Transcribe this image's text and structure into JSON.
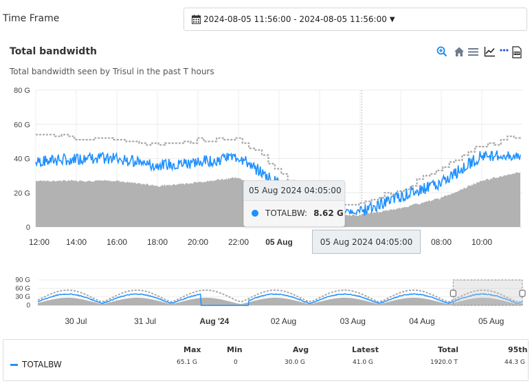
{
  "time_frame": {
    "label": "Time Frame",
    "value": "2024-08-05 11:56:00 - 2024-08-05 11:56:00",
    "icon": "calendar-icon"
  },
  "chart_header": {
    "title": "Total bandwidth",
    "subtitle": "Total bandwidth seen by Trisul in the past T hours"
  },
  "toolbar": {
    "items": [
      "zoom-in-icon",
      "home-icon",
      "menu-icon",
      "line-chart-icon",
      "more-icon",
      "pdf-icon"
    ]
  },
  "tooltip": {
    "time": "05 Aug 2024 04:05:00",
    "series": "TOTALBW:",
    "value": "8.62 G"
  },
  "crosshair_label": "05 Aug 2024 04:05:00",
  "colors": {
    "series_line": "#1e90ff",
    "area": "#b2b2b2",
    "dotted": "#a8a8a8",
    "grid": "#ececec"
  },
  "chart_data": [
    {
      "type": "line",
      "ylim": [
        0,
        80
      ],
      "yticks": [
        "80 G",
        "60 G",
        "40 G",
        "20 G",
        "0"
      ],
      "xticks": [
        "12:00",
        "14:00",
        "16:00",
        "18:00",
        "20:00",
        "22:00",
        "05 Aug",
        "08:00",
        "10:00"
      ],
      "x_hours": [
        0,
        2,
        4,
        6,
        8,
        10,
        14,
        16,
        18,
        20,
        22,
        23.9
      ],
      "series": [
        {
          "name": "TOTALBW",
          "values": [
            38,
            40,
            40,
            36,
            38,
            41,
            9,
            9,
            18,
            26,
            42,
            42
          ]
        },
        {
          "values": [
            55,
            52,
            52,
            48,
            51,
            52,
            12,
            13,
            22,
            34,
            48,
            54
          ]
        },
        {
          "values": [
            27,
            27,
            27,
            24,
            26,
            29,
            6,
            7,
            11,
            17,
            27,
            32
          ]
        }
      ]
    },
    {
      "type": "line",
      "ylim": [
        0,
        90
      ],
      "yticks": [
        "90 G",
        "60 G",
        "30 G",
        "0"
      ],
      "xticks": [
        "30 Jul",
        "31 Jul",
        "Aug '24",
        "02 Aug",
        "03 Aug",
        "04 Aug",
        "05 Aug"
      ],
      "series": [
        {
          "name": "TOTALBW"
        }
      ]
    }
  ],
  "legend": {
    "headers": [
      "Max",
      "Min",
      "Avg",
      "Latest",
      "Total",
      "95th"
    ],
    "rows": [
      {
        "name": "TOTALBW",
        "max": "65.1 G",
        "min": "0",
        "avg": "30.0 G",
        "latest": "41.0 G",
        "total": "1920.0 T",
        "p95": "44.3 G"
      }
    ]
  }
}
